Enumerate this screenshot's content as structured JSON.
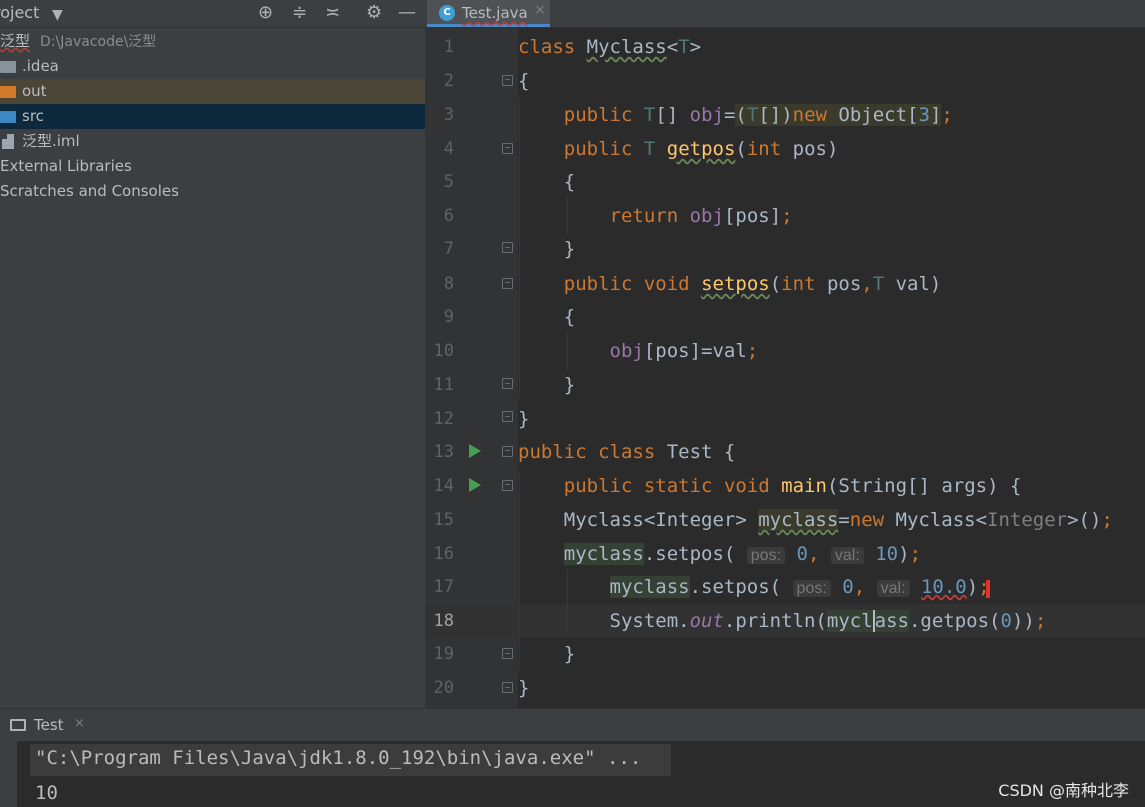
{
  "project_panel": {
    "title": "roject",
    "dropdown_icon": "chevron-down-icon",
    "toolbar_icons": [
      "locate-icon",
      "expand-all-icon",
      "collapse-all-icon",
      "gear-icon",
      "minimize-icon"
    ],
    "tree": [
      {
        "label": "泛型",
        "path": "D:\\Javacode\\泛型",
        "icon": "module-icon"
      },
      {
        "label": ".idea",
        "icon": "folder-icon"
      },
      {
        "label": "out",
        "icon": "folder-icon"
      },
      {
        "label": "src",
        "icon": "folder-icon"
      },
      {
        "label": "泛型.iml",
        "icon": "file-icon"
      },
      {
        "label": "External Libraries",
        "icon": "library-icon"
      },
      {
        "label": "Scratches and Consoles",
        "icon": "scratch-icon"
      }
    ]
  },
  "editor": {
    "tab_label": "Test.java",
    "tab_close": "×",
    "line_numbers": [
      "1",
      "2",
      "3",
      "4",
      "5",
      "6",
      "7",
      "8",
      "9",
      "10",
      "11",
      "12",
      "13",
      "14",
      "15",
      "16",
      "17",
      "18",
      "19",
      "20"
    ],
    "current_line": "18",
    "hints": {
      "pos": "pos:",
      "val": "val:"
    }
  },
  "run_panel": {
    "tab_label": "Test",
    "tab_close": "×",
    "output": [
      "\"C:\\Program Files\\Java\\jdk1.8.0_192\\bin\\java.exe\" ...",
      "10"
    ]
  },
  "watermark": "CSDN @南种北李"
}
